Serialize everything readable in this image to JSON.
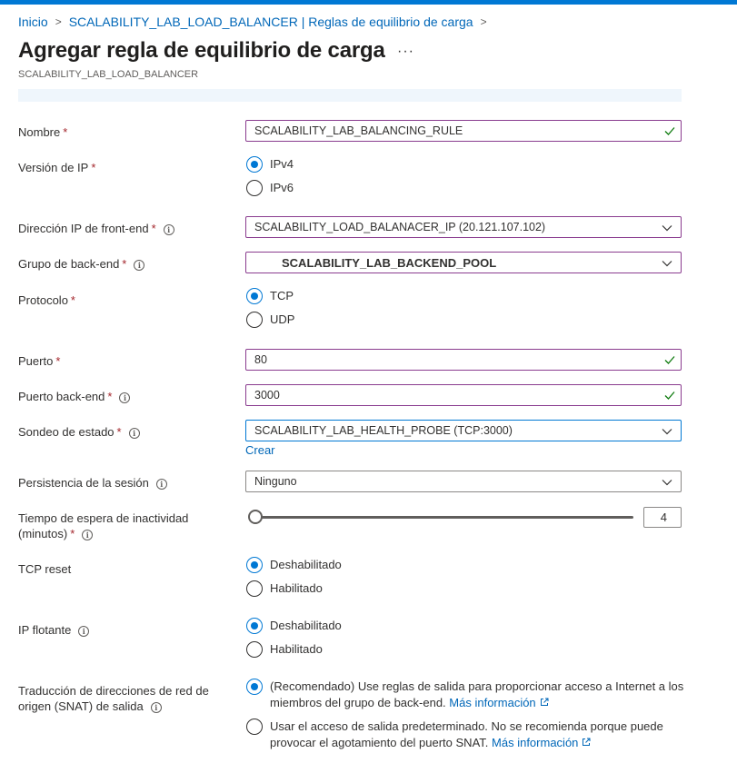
{
  "breadcrumb": {
    "home": "Inicio",
    "parent": "SCALABILITY_LAB_LOAD_BALANCER | Reglas de equilibrio de carga",
    "separator": ">"
  },
  "page": {
    "title": "Agregar regla de equilibrio de carga",
    "subtitle": "SCALABILITY_LAB_LOAD_BALANCER",
    "more": "···"
  },
  "form": {
    "required_mark": "*",
    "info_glyph": "i",
    "name": {
      "label": "Nombre",
      "value": "SCALABILITY_LAB_BALANCING_RULE"
    },
    "ip_version": {
      "label": "Versión de IP",
      "options": [
        "IPv4",
        "IPv6"
      ],
      "selected": "IPv4"
    },
    "frontend_ip": {
      "label": "Dirección IP de front-end",
      "value": "SCALABILITY_LOAD_BALANACER_IP (20.121.107.102)"
    },
    "backend_pool": {
      "label": "Grupo de back-end",
      "value": "SCALABILITY_LAB_BACKEND_POOL"
    },
    "protocol": {
      "label": "Protocolo",
      "options": [
        "TCP",
        "UDP"
      ],
      "selected": "TCP"
    },
    "port": {
      "label": "Puerto",
      "value": "80"
    },
    "backend_port": {
      "label": "Puerto back-end",
      "value": "3000"
    },
    "health_probe": {
      "label": "Sondeo de estado",
      "value": "SCALABILITY_LAB_HEALTH_PROBE (TCP:3000)",
      "create_link": "Crear"
    },
    "session_persistence": {
      "label": "Persistencia de la sesión",
      "value": "Ninguno"
    },
    "idle_timeout": {
      "label_line1": "Tiempo de espera de inactividad",
      "label_line2": "(minutos)",
      "value": "4",
      "level": 0
    },
    "tcp_reset": {
      "label": "TCP reset",
      "options": [
        "Deshabilitado",
        "Habilitado"
      ],
      "selected": "Deshabilitado"
    },
    "floating_ip": {
      "label": "IP flotante",
      "options": [
        "Deshabilitado",
        "Habilitado"
      ],
      "selected": "Deshabilitado"
    },
    "snat": {
      "label_line1": "Traducción de direcciones de red de",
      "label_line2": "origen (SNAT) de salida",
      "option1_text": "(Recomendado) Use reglas de salida para proporcionar acceso a Internet a los miembros del grupo de back-end.",
      "option2_text": "Usar el acceso de salida predeterminado. No se recomienda porque puede provocar el agotamiento del puerto SNAT.",
      "more_info": "Más información"
    }
  },
  "colors": {
    "accent": "#0078d4",
    "link": "#0067b8",
    "field_border": "#8a3c8f",
    "valid_check": "#107c10",
    "required": "#a4262c"
  }
}
